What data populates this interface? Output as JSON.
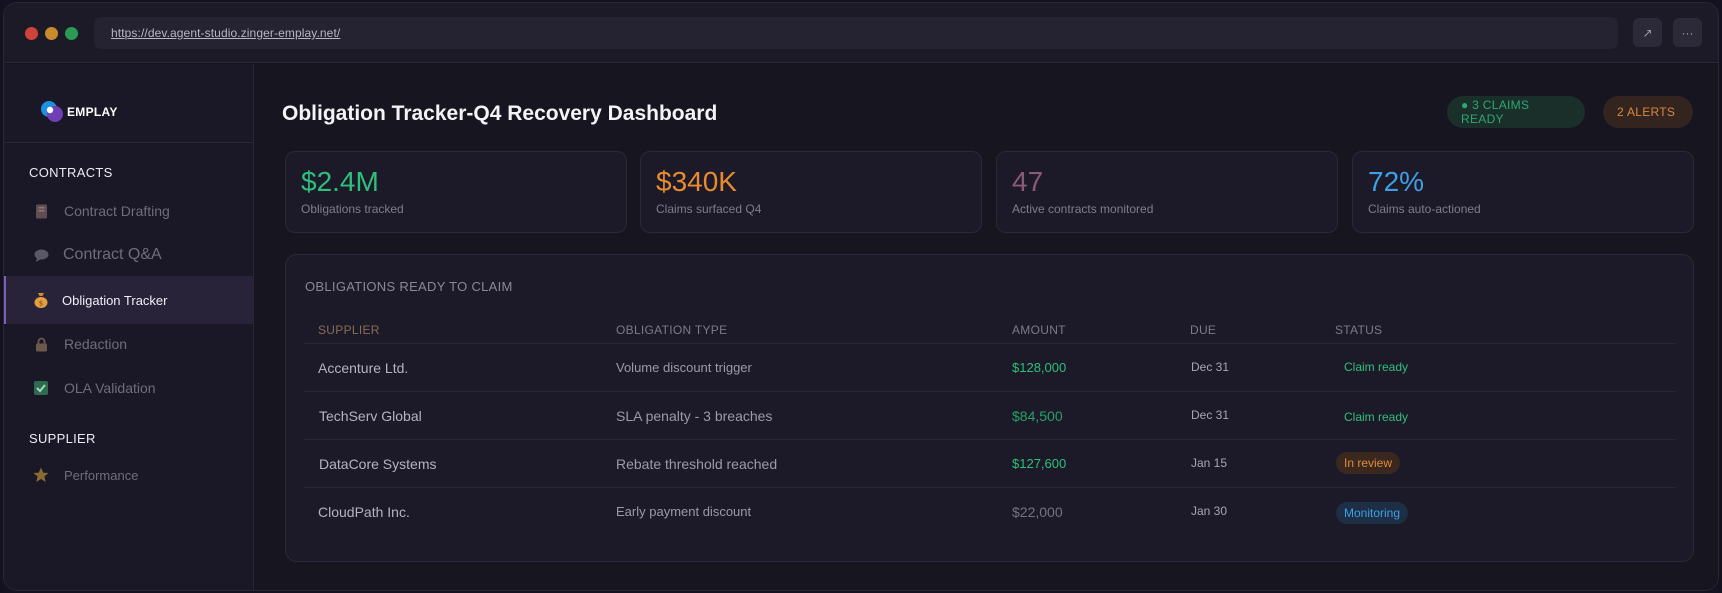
{
  "browser": {
    "url": "https://dev.agent-studio.zinger-emplay.net/",
    "expand_icon": "↗",
    "more_icon": "···"
  },
  "brand": {
    "name": "EMPLAY"
  },
  "sidebar": {
    "sections": [
      {
        "label": "CONTRACTS",
        "items": [
          {
            "label": "Contract Drafting",
            "icon": "notebook-icon"
          },
          {
            "label": "Contract Q&A",
            "icon": "speech-bubble-icon"
          },
          {
            "label": "Obligation Tracker",
            "icon": "money-bag-icon",
            "active": true
          },
          {
            "label": "Redaction",
            "icon": "lock-icon"
          },
          {
            "label": "OLA Validation",
            "icon": "check-box-icon"
          }
        ]
      },
      {
        "label": "SUPPLIER",
        "items": [
          {
            "label": "Performance",
            "icon": "star-icon"
          }
        ]
      }
    ]
  },
  "header": {
    "title": "Obligation Tracker-Q4 Recovery Dashboard",
    "badges": {
      "ready": "● 3 CLAIMS READY",
      "alerts": "2 ALERTS"
    }
  },
  "stats": [
    {
      "value": "$2.4M",
      "caption": "Obligations tracked"
    },
    {
      "value": "$340K",
      "caption": "Claims surfaced Q4"
    },
    {
      "value": "47",
      "caption": "Active contracts monitored"
    },
    {
      "value": "72%",
      "caption": "Claims auto-actioned"
    }
  ],
  "table": {
    "title": "OBLIGATIONS READY TO CLAIM",
    "columns": {
      "supplier": "SUPPLIER",
      "type": "OBLIGATION TYPE",
      "amount": "AMOUNT",
      "due": "DUE",
      "status": "STATUS"
    },
    "rows": [
      {
        "supplier": "Accenture Ltd.",
        "type": "Volume discount trigger",
        "amount": "$128,000",
        "due": "Dec 31",
        "status": "Claim ready"
      },
      {
        "supplier": "TechServ Global",
        "type": "SLA penalty - 3 breaches",
        "amount": "$84,500",
        "due": "Dec 31",
        "status": "Claim ready"
      },
      {
        "supplier": "DataCore Systems",
        "type": "Rebate threshold reached",
        "amount": "$127,600",
        "due": "Jan 15",
        "status": "In review"
      },
      {
        "supplier": "CloudPath Inc.",
        "type": "Early payment discount",
        "amount": "$22,000",
        "due": "Jan 30",
        "status": "Monitoring"
      }
    ]
  },
  "colors": {
    "accent": "#7f5fc0",
    "green": "#2fbf7c",
    "orange": "#e88a30",
    "blue": "#3f9ee6",
    "mauve": "#8a5b78"
  }
}
